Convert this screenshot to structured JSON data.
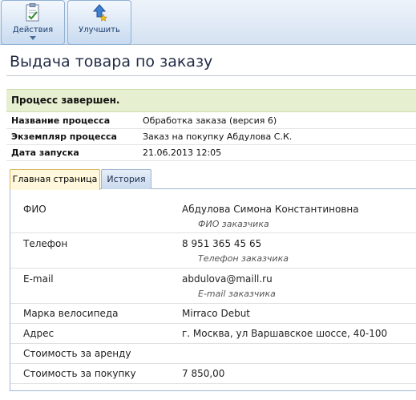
{
  "toolbar": {
    "actions_label": "Действия",
    "improve_label": "Улучшить",
    "actions_icon": "document-check-icon",
    "improve_icon": "upgrade-arrow-icon"
  },
  "page": {
    "title": "Выдача товара по заказу"
  },
  "status": {
    "text": "Процесс завершен."
  },
  "info": [
    {
      "label": "Название процесса",
      "value": "Обработка заказа (версия 6)"
    },
    {
      "label": "Экземпляр процесса",
      "value": "Заказ на покупку Абдулова С.К."
    },
    {
      "label": "Дата запуска",
      "value": "21.06.2013 12:05"
    }
  ],
  "tabs": [
    {
      "label": "Главная страница",
      "active": true
    },
    {
      "label": "История",
      "active": false
    }
  ],
  "form": [
    {
      "label": "ФИО",
      "value": "Абдулова Симона Константиновна",
      "hint": "ФИО заказчика"
    },
    {
      "label": "Телефон",
      "value": "8 951 365 45 65",
      "hint": "Телефон заказчика"
    },
    {
      "label": "E-mail",
      "value": "abdulova@maill.ru",
      "hint": "E-mail заказчика"
    },
    {
      "label": "Марка велосипеда",
      "value": "Mirraco Debut",
      "hint": ""
    },
    {
      "label": "Адрес",
      "value": "г. Москва, ул Варшавское шоссе, 40-100",
      "hint": ""
    },
    {
      "label": "Стоимость за аренду",
      "value": "",
      "hint": ""
    },
    {
      "label": "Стоимость за покупку",
      "value": "7 850,00",
      "hint": ""
    }
  ],
  "colors": {
    "status_bg": "#e6efcf",
    "active_tab_bg": "#fff8dc",
    "toolbar_bg": "#d5e2f2"
  }
}
